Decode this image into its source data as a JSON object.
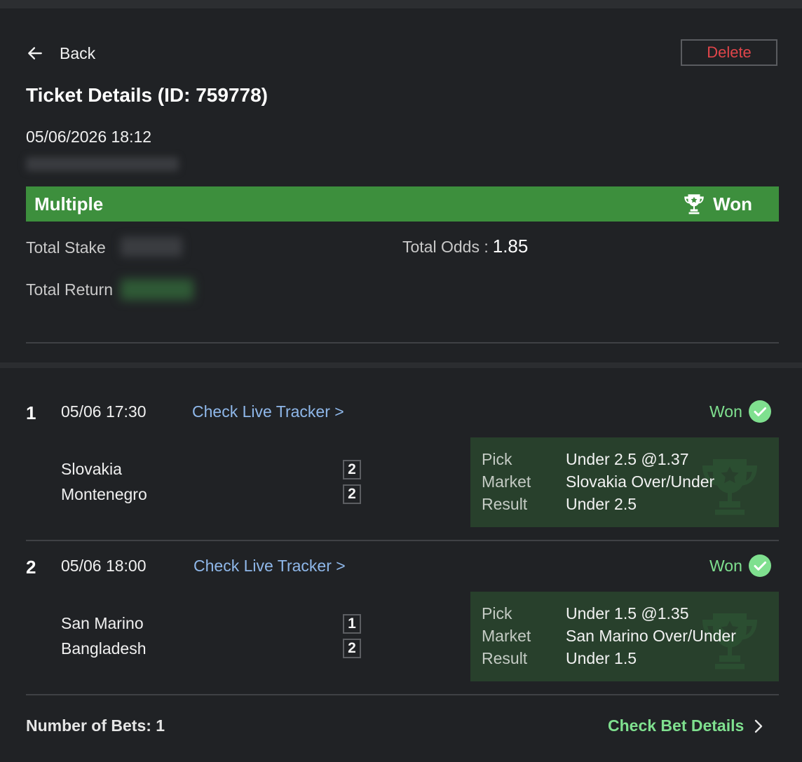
{
  "header": {
    "back_label": "Back",
    "delete_label": "Delete",
    "title": "Ticket Details (ID: 759778)",
    "datetime": "05/06/2026 18:12"
  },
  "summary": {
    "bet_type": "Multiple",
    "status": "Won",
    "total_stake_label": "Total Stake",
    "total_odds_label": "Total Odds :",
    "total_odds_value": "1.85",
    "total_return_label": "Total Return"
  },
  "bets": [
    {
      "number": "1",
      "time": "05/06 17:30",
      "tracker_label": "Check Live Tracker >",
      "status": "Won",
      "home_team": "Slovakia",
      "away_team": "Montenegro",
      "home_score": "2",
      "away_score": "2",
      "pick_label": "Pick",
      "pick_value": "Under 2.5 @1.37",
      "market_label": "Market",
      "market_value": "Slovakia Over/Under",
      "result_label": "Result",
      "result_value": "Under 2.5"
    },
    {
      "number": "2",
      "time": "05/06 18:00",
      "tracker_label": "Check Live Tracker >",
      "status": "Won",
      "home_team": "San Marino",
      "away_team": "Bangladesh",
      "home_score": "1",
      "away_score": "2",
      "pick_label": "Pick",
      "pick_value": "Under 1.5 @1.35",
      "market_label": "Market",
      "market_value": "San Marino Over/Under",
      "result_label": "Result",
      "result_value": "Under 1.5"
    }
  ],
  "footer": {
    "bets_count": "Number of Bets: 1",
    "check_details_label": "Check Bet Details"
  },
  "colors": {
    "won_banner": "#3d8f3d",
    "won_text": "#7fe08f",
    "delete": "#e0454a",
    "link": "#8fb8ea",
    "pick_box": "#28402c"
  },
  "icons": {
    "back": "arrow-left-icon",
    "banner_status": "trophy-icon",
    "bet_status": "check-circle-icon",
    "details": "chevron-right-icon"
  }
}
